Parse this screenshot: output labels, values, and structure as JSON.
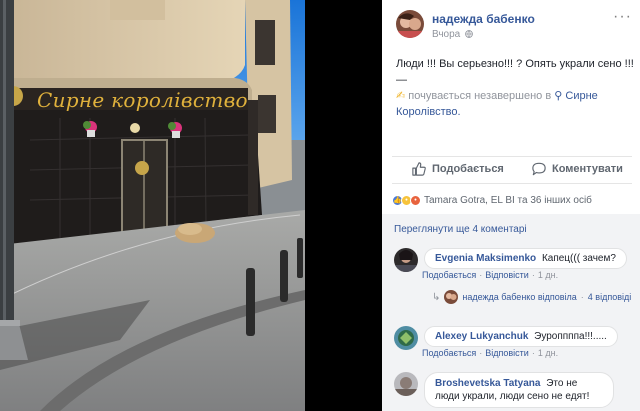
{
  "photo": {
    "shop_sign": "Сирне королівство"
  },
  "post": {
    "author": "надежда бабенко",
    "time": "Вчора",
    "text_line1": "Люди !!! Вы серьезно!!! ? Опять украли сено !!! —",
    "feeling_text": "почувається незавершено в",
    "place": "Сирне Королівство.",
    "more_icon": "more-dots-icon"
  },
  "actions": {
    "like": "Подобається",
    "comment": "Коментувати"
  },
  "reactions": {
    "text": "Tamara Gotra, EL BI та 36 інших осіб",
    "types": [
      "like",
      "wow",
      "angry"
    ]
  },
  "comments": {
    "view_previous": "Переглянути ще 4 коментарі",
    "items": [
      {
        "name": "Evgenia Maksimenko",
        "text": "Капец((( зачем?",
        "like": "Подобається",
        "reply": "Відповісти",
        "time": "1 дн."
      },
      {
        "name": "Alexey Lukyanchuk",
        "text": "Эуроппппа!!!.....",
        "like": "Подобається",
        "reply": "Відповісти",
        "time": "1 дн."
      },
      {
        "name": "Broshevetska Tatyana",
        "text": "Это не люди украли, люди сено не едят!"
      }
    ],
    "reply_summary": {
      "text": "надежда бабенко відповіла",
      "count": "4 відповіді"
    }
  }
}
